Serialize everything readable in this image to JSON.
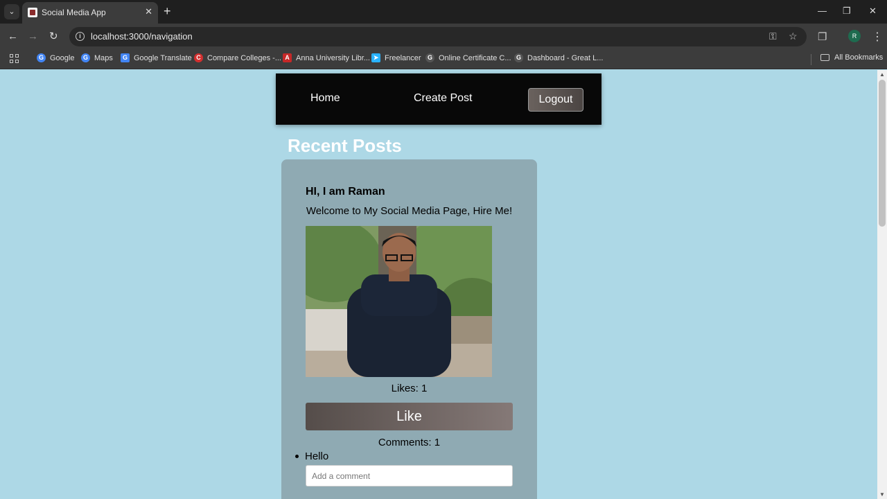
{
  "browser": {
    "tab_title": "Social Media App",
    "url": "localhost:3000/navigation",
    "profile_initial": "R",
    "bookmarks": [
      {
        "label": "Google",
        "icon": "google-icon",
        "color": "#4285f4"
      },
      {
        "label": "Maps",
        "icon": "google-icon",
        "color": "#4285f4"
      },
      {
        "label": "Google Translate",
        "icon": "translate-icon",
        "color": "#4285f4"
      },
      {
        "label": "Compare Colleges -...",
        "icon": "compare-icon",
        "color": "#d32f2f"
      },
      {
        "label": "Anna University Libr...",
        "icon": "university-icon",
        "color": "#c62828"
      },
      {
        "label": "Freelancer",
        "icon": "freelancer-icon",
        "color": "#29b2fe"
      },
      {
        "label": "Online Certificate C...",
        "icon": "google-icon",
        "color": "#555555"
      },
      {
        "label": "Dashboard - Great L...",
        "icon": "google-icon",
        "color": "#555555"
      }
    ],
    "all_bookmarks_label": "All Bookmarks"
  },
  "nav": {
    "home_label": "Home",
    "create_post_label": "Create Post",
    "logout_label": "Logout"
  },
  "main": {
    "section_title": "Recent Posts",
    "post": {
      "title": "HI, I am Raman",
      "body": "Welcome to My Social Media Page, Hire Me!",
      "likes_text": "Likes: 1",
      "like_button_label": "Like",
      "comments_text": "Comments: 1",
      "comments": [
        "Hello"
      ],
      "comment_placeholder": "Add a comment"
    }
  },
  "colors": {
    "page_bg": "#add8e6",
    "navbar_bg": "#080808",
    "card_bg": "#8faab3"
  }
}
